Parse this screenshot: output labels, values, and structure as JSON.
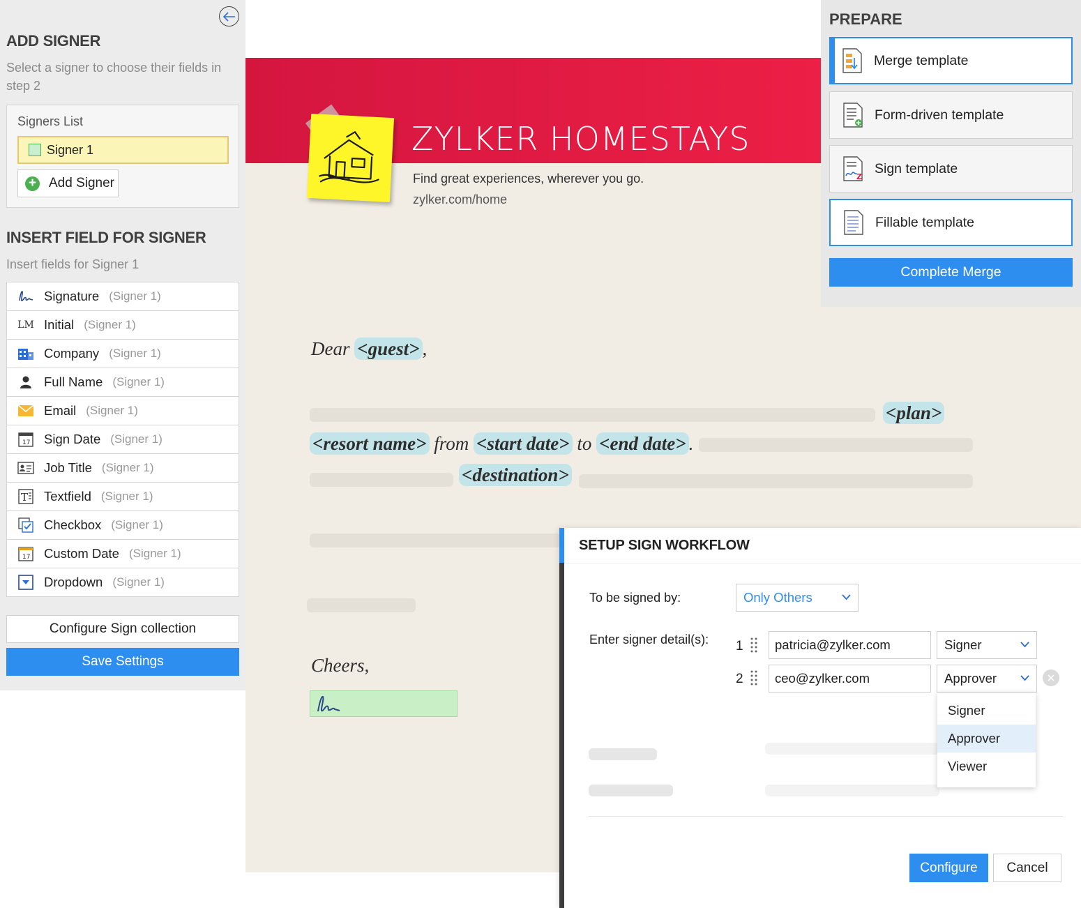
{
  "left_panel": {
    "add_signer_heading": "ADD SIGNER",
    "add_signer_sub": "Select a signer to choose their fields in step 2",
    "signers_list_label": "Signers List",
    "signers": [
      "Signer 1"
    ],
    "add_signer_button": "Add Signer",
    "insert_heading": "INSERT FIELD FOR SIGNER",
    "insert_sub": "Insert fields for Signer 1",
    "fields": [
      {
        "label": "Signature",
        "tag": "(Signer 1)",
        "icon": "signature-icon"
      },
      {
        "label": "Initial",
        "tag": "(Signer 1)",
        "icon": "initial-icon"
      },
      {
        "label": "Company",
        "tag": "(Signer 1)",
        "icon": "company-icon"
      },
      {
        "label": "Full Name",
        "tag": "(Signer 1)",
        "icon": "person-icon"
      },
      {
        "label": "Email",
        "tag": "(Signer 1)",
        "icon": "email-icon"
      },
      {
        "label": "Sign Date",
        "tag": "(Signer 1)",
        "icon": "calendar-icon"
      },
      {
        "label": "Job Title",
        "tag": "(Signer 1)",
        "icon": "id-card-icon"
      },
      {
        "label": "Textfield",
        "tag": "(Signer 1)",
        "icon": "textfield-icon"
      },
      {
        "label": "Checkbox",
        "tag": "(Signer 1)",
        "icon": "checkbox-icon"
      },
      {
        "label": "Custom Date",
        "tag": "(Signer 1)",
        "icon": "calendar-icon"
      },
      {
        "label": "Dropdown",
        "tag": "(Signer 1)",
        "icon": "dropdown-icon"
      }
    ],
    "configure_collection_button": "Configure Sign collection",
    "save_settings_button": "Save Settings"
  },
  "document": {
    "brand_title": "ZYLKER HOMESTAYS",
    "tagline": "Find great experiences, wherever you go.",
    "url": "zylker.com/home",
    "dear": "Dear",
    "guest_tag": "<guest>",
    "comma": ",",
    "plan_tag": "<plan>",
    "resort_tag": "<resort name>",
    "from_word": "from",
    "start_tag": "<start date>",
    "to_word": "to",
    "end_tag": "<end date>",
    "period": ".",
    "destination_tag": "<destination>",
    "cheers": "Cheers,"
  },
  "prepare": {
    "title": "PREPARE",
    "options": [
      {
        "label": "Merge template",
        "icon": "merge-template-icon",
        "state": "active"
      },
      {
        "label": "Form-driven template",
        "icon": "form-template-icon",
        "state": "normal"
      },
      {
        "label": "Sign template",
        "icon": "sign-template-icon",
        "state": "normal"
      },
      {
        "label": "Fillable template",
        "icon": "fillable-template-icon",
        "state": "outlined"
      }
    ],
    "complete_button": "Complete Merge"
  },
  "workflow": {
    "title": "SETUP SIGN WORKFLOW",
    "signed_by_label": "To be signed by:",
    "signed_by_value": "Only Others",
    "signer_details_label": "Enter signer detail(s):",
    "rows": [
      {
        "num": "1",
        "email": "patricia@zylker.com",
        "role": "Signer"
      },
      {
        "num": "2",
        "email": "ceo@zylker.com",
        "role": "Approver"
      }
    ],
    "role_options": [
      "Signer",
      "Approver",
      "Viewer"
    ],
    "highlighted_option": "Approver",
    "configure_button": "Configure",
    "cancel_button": "Cancel"
  },
  "colors": {
    "accent": "#2e8ef0",
    "banner": "#e31b43",
    "merge_tag": "#c3e4e8",
    "signer_highlight": "#fbf6b8"
  }
}
